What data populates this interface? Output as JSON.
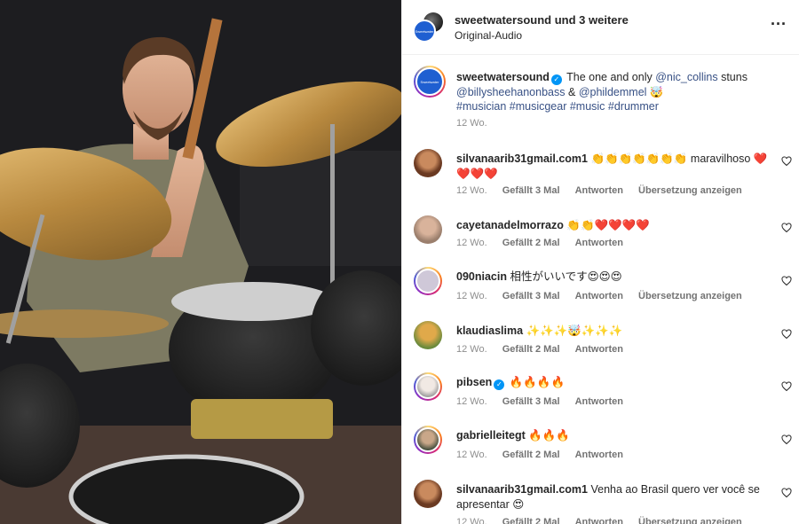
{
  "header": {
    "username": "sweetwatersound",
    "others": "und 3 weitere",
    "audio": "Original-Audio",
    "more": "···",
    "avatar_text": "Sweetwater"
  },
  "caption": {
    "username": "sweetwatersound",
    "text_1": "The one and only",
    "mention_1": "@nic_collins",
    "text_2": "stuns",
    "mention_2": "@billysheehanonbass",
    "amp": "&",
    "mention_3": "@phildemmel",
    "emoji": "🤯",
    "hashtags": "#musician #musicgear #music #drummer",
    "time": "12 Wo."
  },
  "comments": [
    {
      "username": "silvanaarib31gmail.com1",
      "text": "👏👏👏👏👏👏👏 maravilhoso ❤️❤️❤️❤️",
      "time": "12 Wo.",
      "likes": "Gefällt 3 Mal",
      "reply": "Antworten",
      "translate": "Übersetzung anzeigen"
    },
    {
      "username": "cayetanadelmorrazo",
      "text": "👏👏❤️❤️❤️❤️",
      "time": "12 Wo.",
      "likes": "Gefällt 2 Mal",
      "reply": "Antworten"
    },
    {
      "username": "090niacin",
      "text": "相性がいいです😍😍😍",
      "time": "12 Wo.",
      "likes": "Gefällt 3 Mal",
      "reply": "Antworten",
      "translate": "Übersetzung anzeigen"
    },
    {
      "username": "klaudiaslima",
      "text": "✨✨✨🤯✨✨✨",
      "time": "12 Wo.",
      "likes": "Gefällt 2 Mal",
      "reply": "Antworten"
    },
    {
      "username": "pibsen",
      "text": "🔥🔥🔥🔥",
      "time": "12 Wo.",
      "likes": "Gefällt 3 Mal",
      "reply": "Antworten"
    },
    {
      "username": "gabrielleitegt",
      "text": "🔥🔥🔥",
      "time": "12 Wo.",
      "likes": "Gefällt 2 Mal",
      "reply": "Antworten"
    },
    {
      "username": "silvanaarib31gmail.com1",
      "text": "Venha ao Brasil quero ver você se apresentar 😍",
      "time": "12 Wo.",
      "likes": "Gefällt 2 Mal",
      "reply": "Antworten",
      "translate": "Übersetzung anzeigen"
    }
  ],
  "icons": {
    "heart": "heart-outline-icon",
    "more": "more-horizontal-icon",
    "verified": "verified-badge-icon"
  }
}
